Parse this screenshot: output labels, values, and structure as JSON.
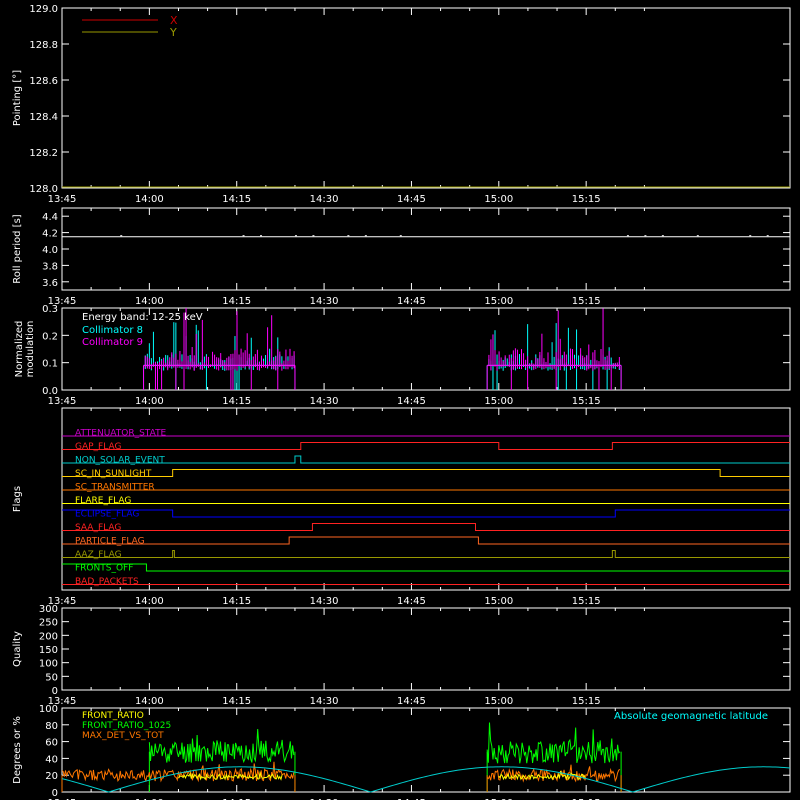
{
  "x_axis": {
    "range_minutes": [
      0,
      125
    ],
    "tick_labels": [
      "13:45",
      "14:00",
      "14:15",
      "14:30",
      "14:45",
      "15:00",
      "15:15"
    ]
  },
  "chart_data": [
    {
      "type": "line",
      "panel": "pointing",
      "ylabel": "Pointing [°]",
      "ylim": [
        128.0,
        129.0
      ],
      "y_ticks": [
        "128.0",
        "128.2",
        "128.4",
        "128.6",
        "128.8",
        "129.0"
      ],
      "legend": [
        {
          "label": "X",
          "color": "#cc0000"
        },
        {
          "label": "Y",
          "color": "#999900"
        }
      ],
      "series": [
        {
          "name": "Y",
          "color": "#999900",
          "x": [
            0,
            125
          ],
          "y": [
            128.0,
            128.0
          ]
        }
      ]
    },
    {
      "type": "line",
      "panel": "roll",
      "ylabel": "Roll period [s]",
      "ylim": [
        3.5,
        4.5
      ],
      "y_ticks": [
        "3.6",
        "3.8",
        "4.0",
        "4.2",
        "4.4"
      ],
      "series": [
        {
          "color": "#ffffff",
          "x": [
            0,
            125
          ],
          "y": [
            4.15,
            4.15
          ]
        }
      ]
    },
    {
      "type": "line",
      "panel": "modulation",
      "ylabel": [
        "Normalized",
        "modulation"
      ],
      "ylim": [
        0,
        0.3
      ],
      "y_ticks": [
        "0.0",
        "0.1",
        "0.2",
        "0.3"
      ],
      "annotation": "Energy band: 12-25 keV",
      "legend": [
        {
          "label": "Collimator 8",
          "color": "#00ffff"
        },
        {
          "label": "Collimator 9",
          "color": "#ff00ff"
        }
      ],
      "series": [
        {
          "name": "Collimator 8",
          "color": "#00ffff",
          "segments": [
            [
              14,
              40
            ],
            [
              73,
              96
            ]
          ],
          "baseline": 0.09,
          "noise": 0.12,
          "seed": 3
        },
        {
          "name": "Collimator 9",
          "color": "#ff00ff",
          "segments": [
            [
              14,
              40
            ],
            [
              73,
              96
            ]
          ],
          "baseline": 0.09,
          "noise": 0.18,
          "seed": 7
        }
      ]
    },
    {
      "type": "line",
      "panel": "flags",
      "ylabel": "Flags",
      "series": [
        {
          "name": "ATTENUATOR_STATE",
          "color": "#cc00cc",
          "steps": [
            [
              0,
              0
            ],
            [
              125,
              0
            ]
          ]
        },
        {
          "name": "GAP_FLAG",
          "color": "#ff2222",
          "steps": [
            [
              0,
              0
            ],
            [
              41,
              1
            ],
            [
              75,
              0
            ],
            [
              94.5,
              1
            ],
            [
              125,
              1
            ]
          ]
        },
        {
          "name": "NON_SOLAR_EVENT",
          "color": "#00cccc",
          "steps": [
            [
              0,
              0
            ],
            [
              40,
              1
            ],
            [
              41,
              0
            ],
            [
              125,
              0
            ]
          ]
        },
        {
          "name": "SC_IN_SUNLIGHT",
          "color": "#ffcc00",
          "steps": [
            [
              0,
              0
            ],
            [
              19,
              1
            ],
            [
              113,
              0
            ],
            [
              125,
              0
            ]
          ]
        },
        {
          "name": "SC_TRANSMITTER",
          "color": "#ff7700",
          "steps": [
            [
              0,
              0
            ],
            [
              125,
              0
            ]
          ]
        },
        {
          "name": "FLARE_FLAG",
          "color": "#ffff00",
          "steps": [
            [
              0,
              0
            ],
            [
              125,
              0
            ]
          ]
        },
        {
          "name": "ECLIPSE_FLAG",
          "color": "#0000ff",
          "steps": [
            [
              0,
              1
            ],
            [
              19,
              0
            ],
            [
              95,
              1
            ],
            [
              125,
              1
            ]
          ]
        },
        {
          "name": "SAA_FLAG",
          "color": "#ff2222",
          "steps": [
            [
              0,
              0
            ],
            [
              43,
              1
            ],
            [
              71,
              0
            ],
            [
              125,
              0
            ]
          ]
        },
        {
          "name": "PARTICLE_FLAG",
          "color": "#ff6622",
          "steps": [
            [
              0,
              0
            ],
            [
              39,
              1
            ],
            [
              71.5,
              0
            ],
            [
              125,
              0
            ]
          ]
        },
        {
          "name": "AAZ_FLAG",
          "color": "#999900",
          "steps": [
            [
              0,
              0
            ],
            [
              19,
              1
            ],
            [
              19.3,
              0
            ],
            [
              94.5,
              1
            ],
            [
              95,
              0
            ],
            [
              125,
              0
            ]
          ]
        },
        {
          "name": "FRONTS_OFF",
          "color": "#00ff00",
          "steps": [
            [
              0,
              1
            ],
            [
              14.5,
              0
            ],
            [
              125,
              0
            ]
          ]
        },
        {
          "name": "BAD_PACKETS",
          "color": "#ff2222",
          "steps": [
            [
              0,
              0
            ],
            [
              125,
              0
            ]
          ]
        }
      ]
    },
    {
      "type": "line",
      "panel": "quality",
      "ylabel": "Quality",
      "ylim": [
        0,
        300
      ],
      "y_ticks": [
        "0",
        "50",
        "100",
        "150",
        "200",
        "250",
        "300"
      ],
      "series": []
    },
    {
      "type": "line",
      "panel": "ratio",
      "ylabel": "Degrees or %",
      "ylim": [
        0,
        100
      ],
      "y_ticks": [
        "0",
        "20",
        "40",
        "60",
        "80",
        "100"
      ],
      "legend": [
        {
          "label": "FRONT_RATIO",
          "color": "#ffff00"
        },
        {
          "label": "FRONT_RATIO_1025",
          "color": "#00ff00"
        },
        {
          "label": "MAX_DET_VS_TOT",
          "color": "#ff7700"
        }
      ],
      "annotation": "Absolute geomagnetic latitude",
      "annotation_color": "#00ffff",
      "series": [
        {
          "name": "FRONT_RATIO_1025",
          "color": "#00ff00",
          "segments": [
            [
              15,
              40
            ],
            [
              73,
              96
            ]
          ],
          "baseline": 48,
          "noise": 14,
          "seed": 11
        },
        {
          "name": "MAX_DET_VS_TOT",
          "color": "#ff7700",
          "segments": [
            [
              0,
              40
            ],
            [
              73,
              96
            ]
          ],
          "baseline": 20,
          "noise": 7,
          "seed": 5
        },
        {
          "name": "FRONT_RATIO",
          "color": "#ffff00",
          "segments": [
            [
              20,
              38
            ],
            [
              75,
              90
            ]
          ],
          "baseline": 18,
          "noise": 3,
          "seed": 9
        },
        {
          "name": "Absolute geomagnetic latitude",
          "color": "#00cccc",
          "kind": "latitude",
          "amplitude": 30,
          "period_minutes": 45,
          "phase_minutes": 8
        }
      ]
    }
  ]
}
